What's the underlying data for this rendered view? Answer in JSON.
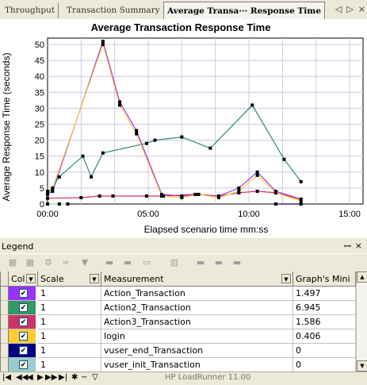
{
  "tabs": [
    {
      "label": "Throughput",
      "active": false
    },
    {
      "label": "Transaction Summary",
      "active": false
    },
    {
      "label": "Average Transa··· Response Time",
      "active": true
    }
  ],
  "tab_nav": {
    "prev": "◁",
    "next": "▷",
    "close": "×"
  },
  "chart_data": {
    "type": "line",
    "title": "Average Transaction Response Time",
    "xlabel": "Elapsed scenario time mm:ss",
    "ylabel": "Average Response Time (seconds)",
    "ylim": [
      0,
      52
    ],
    "xlim": [
      0,
      940
    ],
    "x_ticks": [
      {
        "value": 0,
        "label": "00:00"
      },
      {
        "value": 300,
        "label": "05:00"
      },
      {
        "value": 600,
        "label": "10:00"
      },
      {
        "value": 900,
        "label": "15:00"
      }
    ],
    "y_ticks": [
      0,
      5,
      10,
      15,
      20,
      25,
      30,
      35,
      40,
      45,
      50
    ],
    "grid": true,
    "series": [
      {
        "name": "Action_Transaction",
        "color": "#9933ff",
        "points": [
          [
            0,
            3
          ],
          [
            15,
            4
          ],
          [
            165,
            51
          ],
          [
            215,
            32
          ],
          [
            265,
            23
          ],
          [
            340,
            3
          ],
          [
            400,
            2.5
          ],
          [
            450,
            3
          ],
          [
            510,
            2.5
          ],
          [
            570,
            5
          ],
          [
            625,
            10
          ],
          [
            680,
            4
          ],
          [
            755,
            1.5
          ]
        ]
      },
      {
        "name": "Action2_Transaction",
        "color": "#2e8b6e",
        "points": [
          [
            0,
            3
          ],
          [
            35,
            8.5
          ],
          [
            105,
            15
          ],
          [
            130,
            8.5
          ],
          [
            165,
            16
          ],
          [
            295,
            19
          ],
          [
            320,
            20
          ],
          [
            400,
            21
          ],
          [
            485,
            17.5
          ],
          [
            610,
            31
          ],
          [
            705,
            14
          ],
          [
            755,
            7
          ]
        ]
      },
      {
        "name": "Action3_Transaction",
        "color": "#cc3366",
        "points": [
          [
            0,
            1.8
          ],
          [
            100,
            2
          ],
          [
            155,
            2.5
          ],
          [
            195,
            2.5
          ],
          [
            295,
            2.5
          ],
          [
            345,
            2.5
          ],
          [
            440,
            3
          ],
          [
            510,
            2.5
          ],
          [
            570,
            3.5
          ],
          [
            625,
            4
          ],
          [
            680,
            3.5
          ],
          [
            755,
            1.5
          ]
        ]
      },
      {
        "name": "login",
        "color": "#ffcc33",
        "points": [
          [
            0,
            4
          ],
          [
            15,
            5
          ],
          [
            165,
            50
          ],
          [
            215,
            31
          ],
          [
            265,
            22
          ],
          [
            340,
            2.5
          ],
          [
            400,
            2
          ],
          [
            450,
            3
          ],
          [
            510,
            2
          ],
          [
            570,
            4
          ],
          [
            625,
            9
          ],
          [
            680,
            3.5
          ],
          [
            755,
            1
          ]
        ]
      },
      {
        "name": "vuser_end_Transaction",
        "color": "#000080",
        "points": [
          [
            680,
            0
          ],
          [
            755,
            0
          ]
        ]
      },
      {
        "name": "vuser_init_Transaction",
        "color": "#99cccc",
        "points": [
          [
            0,
            0
          ],
          [
            35,
            0
          ],
          [
            60,
            0
          ]
        ]
      }
    ]
  },
  "legend": {
    "title": "Legend",
    "pin_icon": "pin-icon",
    "columns": [
      {
        "label": "Col"
      },
      {
        "label": "Scale"
      },
      {
        "label": "Measurement"
      },
      {
        "label": "Graph's Mini"
      }
    ],
    "rows": [
      {
        "color": "#9933ff",
        "checked": "✔",
        "scale": "1",
        "measurement": "Action_Transaction",
        "graph_min": "1.497"
      },
      {
        "color": "#339966",
        "checked": "✔",
        "scale": "1",
        "measurement": "Action2_Transaction",
        "graph_min": "6.945"
      },
      {
        "color": "#cc3366",
        "checked": "✔",
        "scale": "1",
        "measurement": "Action3_Transaction",
        "graph_min": "1.586"
      },
      {
        "color": "#ffcc33",
        "checked": "✔",
        "scale": "1",
        "measurement": "login",
        "graph_min": "0.406"
      },
      {
        "color": "#000080",
        "checked": "✔",
        "scale": "1",
        "measurement": "vuser_end_Transaction",
        "graph_min": "0"
      },
      {
        "color": "#99cccc",
        "checked": "✔",
        "scale": "1",
        "measurement": "vuser_init_Transaction",
        "graph_min": "0"
      }
    ]
  },
  "status_text": "HP LoadRunner 11.00"
}
